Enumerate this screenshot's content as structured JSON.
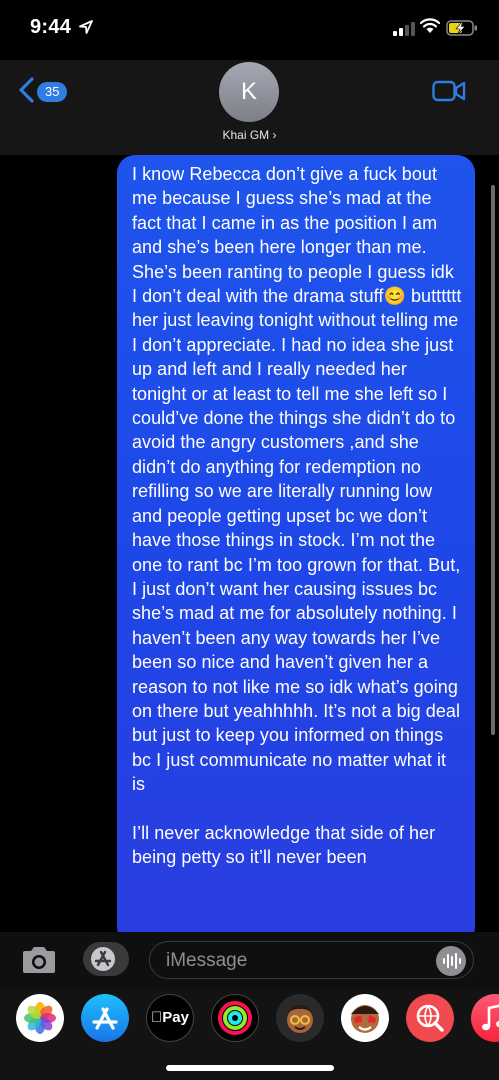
{
  "status_bar": {
    "time": "9:44"
  },
  "header": {
    "back_badge": "35",
    "avatar_initial": "K",
    "contact_name": "Khai GM ›"
  },
  "message": {
    "paragraph1": "I know Rebecca don’t give a fuck bout me because I guess she’s mad at the fact that I came in as the position I am and she’s been here longer than me. She’s been ranting to people I guess idk I don’t deal with the drama stuff😊  butttttt her just leaving tonight without telling me I don’t appreciate. I had no idea she just up and left and I really needed her tonight or at least to tell me she left so I could’ve done the things she didn’t do to avoid the angry customers ,and she didn’t do anything for redemption no refilling so we are literally running low and people getting upset bc we don’t have those things in stock. I’m not the one to rant bc I’m too grown for that. But, I just don’t want her causing issues bc she’s mad at me for absolutely nothing. I haven’t been any way towards her I’ve been so nice and haven’t given her a reason to not like me so idk what’s going on there but yeahhhhh. It’s not a big deal but just to keep you informed on things bc I just communicate no matter what it is",
    "paragraph2": "I’ll never acknowledge that side of her being petty so it’ll never been"
  },
  "compose": {
    "placeholder": "iMessage"
  },
  "drawer": {
    "apple_pay_label": "Pay"
  },
  "colors": {
    "bubble": "#1f55ec",
    "accent": "#2f7de0"
  }
}
